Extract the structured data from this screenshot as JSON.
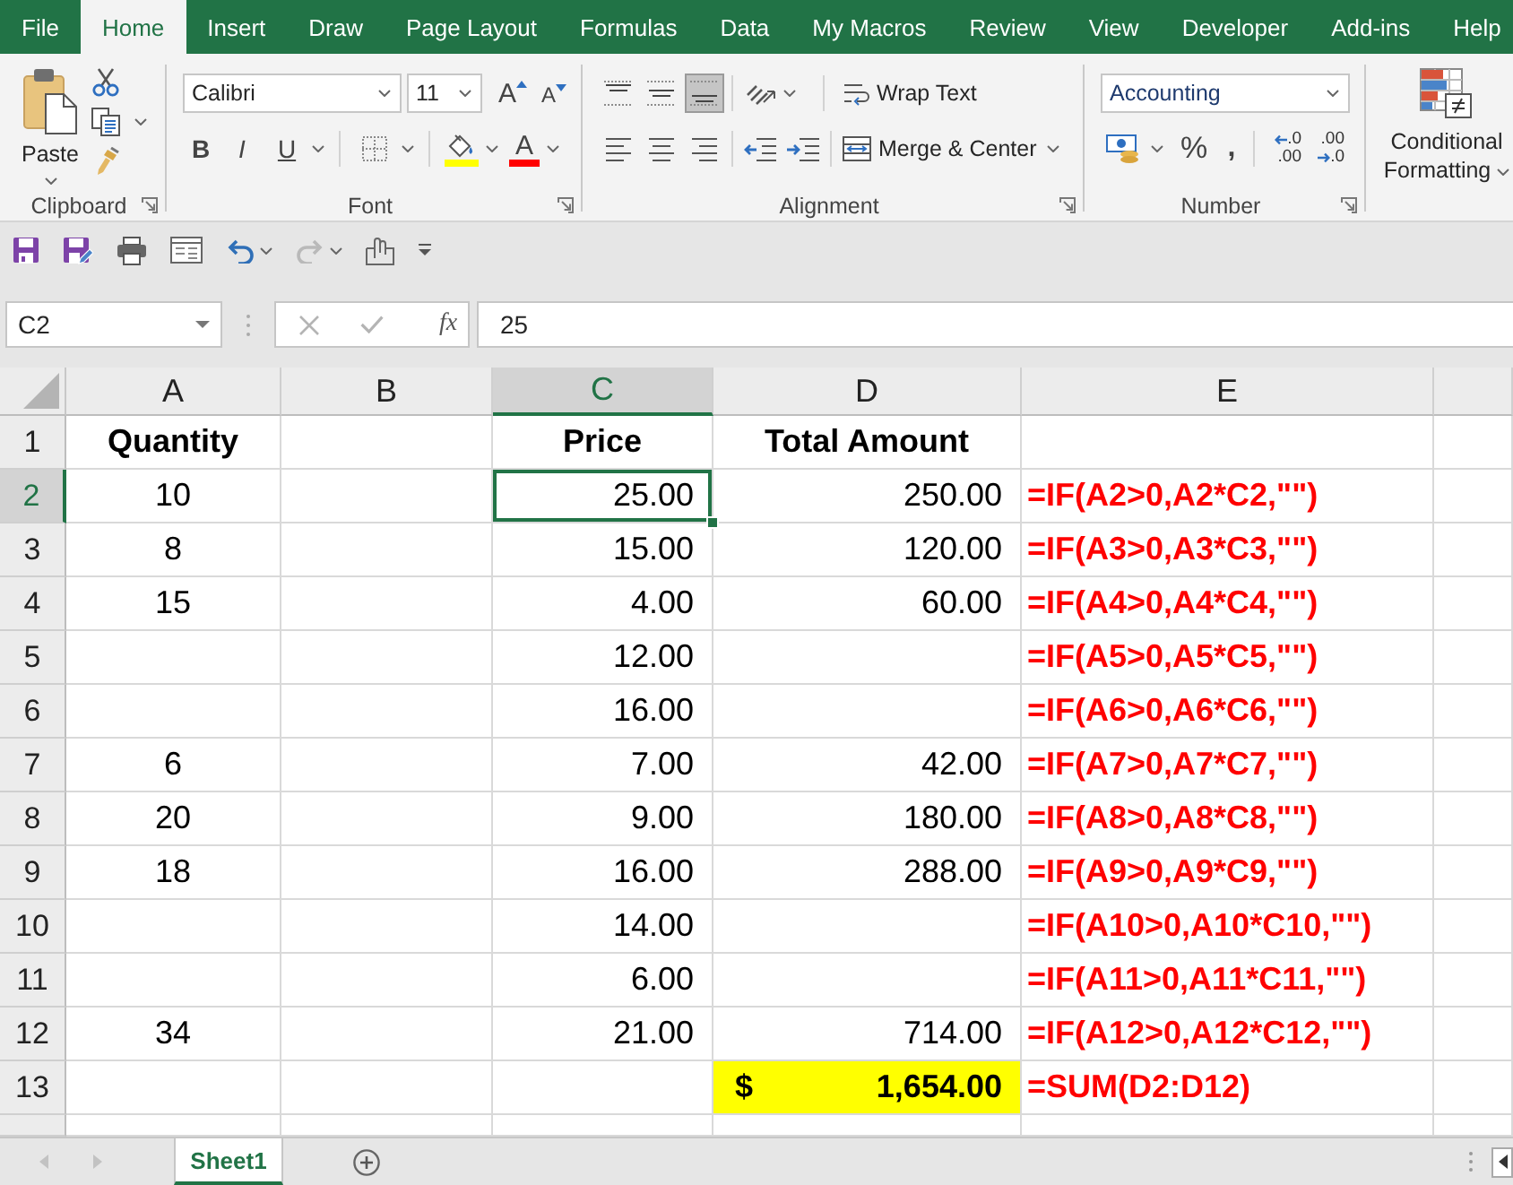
{
  "ribbon_tabs": [
    {
      "label": "File",
      "selected": false
    },
    {
      "label": "Home",
      "selected": true
    },
    {
      "label": "Insert",
      "selected": false
    },
    {
      "label": "Draw",
      "selected": false
    },
    {
      "label": "Page Layout",
      "selected": false
    },
    {
      "label": "Formulas",
      "selected": false
    },
    {
      "label": "Data",
      "selected": false
    },
    {
      "label": "My Macros",
      "selected": false
    },
    {
      "label": "Review",
      "selected": false
    },
    {
      "label": "View",
      "selected": false
    },
    {
      "label": "Developer",
      "selected": false
    },
    {
      "label": "Add-ins",
      "selected": false
    },
    {
      "label": "Help",
      "selected": false
    }
  ],
  "ribbon": {
    "clipboard": {
      "paste": "Paste",
      "label": "Clipboard"
    },
    "font": {
      "name": "Calibri",
      "size": "11",
      "grow": "A",
      "shrink": "A",
      "bold": "B",
      "italic": "I",
      "underline": "U",
      "text_tint": "A",
      "label": "Font"
    },
    "alignment": {
      "vertical": [
        {
          "kind": "top",
          "selected": false
        },
        {
          "kind": "middle",
          "selected": false
        },
        {
          "kind": "bottom",
          "selected": true
        }
      ],
      "horizontal": [
        {
          "kind": "left",
          "selected": false
        },
        {
          "kind": "center",
          "selected": false
        },
        {
          "kind": "right",
          "selected": false
        }
      ],
      "wrap_text": "Wrap Text",
      "merge_center": "Merge & Center",
      "label": "Alignment"
    },
    "number": {
      "format": "Accounting",
      "percent": "%",
      "comma": ",",
      "increase_decimal": [
        ".0",
        ".00"
      ],
      "decrease_decimal": [
        ".00",
        ".0"
      ],
      "label": "Number"
    },
    "styles": {
      "conditional_formatting": "Conditional Formatting"
    }
  },
  "quick_access": [
    {
      "kind": "save",
      "disabled": false
    },
    {
      "kind": "save_as",
      "disabled": false
    },
    {
      "kind": "print",
      "disabled": false
    },
    {
      "kind": "form",
      "disabled": false
    },
    {
      "kind": "undo",
      "disabled": false
    },
    {
      "kind": "redo",
      "disabled": true
    },
    {
      "kind": "touch",
      "disabled": false
    },
    {
      "kind": "customize",
      "disabled": false
    }
  ],
  "formula_bar": {
    "name_box": "C2",
    "edit_buttons_disabled": true,
    "function": "fx",
    "value": "25"
  },
  "grid": {
    "columns": [
      {
        "label": "A",
        "selected": false
      },
      {
        "label": "B",
        "selected": false
      },
      {
        "label": "C",
        "selected": true
      },
      {
        "label": "D",
        "selected": false
      },
      {
        "label": "E",
        "selected": false
      }
    ],
    "rows": [
      {
        "header": "1",
        "selected": false,
        "cells": [
          {
            "kind": "heading",
            "text": "Quantity",
            "selected": false
          },
          {
            "selected": false
          },
          {
            "kind": "heading",
            "text": "Price",
            "selected": false
          },
          {
            "kind": "heading",
            "text": "Total Amount",
            "selected": false
          },
          {
            "selected": false
          }
        ]
      },
      {
        "header": "2",
        "selected": true,
        "cells": [
          {
            "kind": "count",
            "text": "10",
            "selected": false
          },
          {
            "selected": false
          },
          {
            "kind": "amount",
            "text": "25.00",
            "selected": true
          },
          {
            "kind": "amount",
            "text": "250.00",
            "selected": false
          },
          {
            "kind": "formula",
            "text": "=IF(A2>0,A2*C2,\"\")",
            "selected": false
          }
        ]
      },
      {
        "header": "3",
        "selected": false,
        "cells": [
          {
            "kind": "count",
            "text": "8",
            "selected": false
          },
          {
            "selected": false
          },
          {
            "kind": "amount",
            "text": "15.00",
            "selected": false
          },
          {
            "kind": "amount",
            "text": "120.00",
            "selected": false
          },
          {
            "kind": "formula",
            "text": "=IF(A3>0,A3*C3,\"\")",
            "selected": false
          }
        ]
      },
      {
        "header": "4",
        "selected": false,
        "cells": [
          {
            "kind": "count",
            "text": "15",
            "selected": false
          },
          {
            "selected": false
          },
          {
            "kind": "amount",
            "text": "4.00",
            "selected": false
          },
          {
            "kind": "amount",
            "text": "60.00",
            "selected": false
          },
          {
            "kind": "formula",
            "text": "=IF(A4>0,A4*C4,\"\")",
            "selected": false
          }
        ]
      },
      {
        "header": "5",
        "selected": false,
        "cells": [
          {
            "selected": false
          },
          {
            "selected": false
          },
          {
            "kind": "amount",
            "text": "12.00",
            "selected": false
          },
          {
            "selected": false
          },
          {
            "kind": "formula",
            "text": "=IF(A5>0,A5*C5,\"\")",
            "selected": false
          }
        ]
      },
      {
        "header": "6",
        "selected": false,
        "cells": [
          {
            "selected": false
          },
          {
            "selected": false
          },
          {
            "kind": "amount",
            "text": "16.00",
            "selected": false
          },
          {
            "selected": false
          },
          {
            "kind": "formula",
            "text": "=IF(A6>0,A6*C6,\"\")",
            "selected": false
          }
        ]
      },
      {
        "header": "7",
        "selected": false,
        "cells": [
          {
            "kind": "count",
            "text": "6",
            "selected": false
          },
          {
            "selected": false
          },
          {
            "kind": "amount",
            "text": "7.00",
            "selected": false
          },
          {
            "kind": "amount",
            "text": "42.00",
            "selected": false
          },
          {
            "kind": "formula",
            "text": "=IF(A7>0,A7*C7,\"\")",
            "selected": false
          }
        ]
      },
      {
        "header": "8",
        "selected": false,
        "cells": [
          {
            "kind": "count",
            "text": "20",
            "selected": false
          },
          {
            "selected": false
          },
          {
            "kind": "amount",
            "text": "9.00",
            "selected": false
          },
          {
            "kind": "amount",
            "text": "180.00",
            "selected": false
          },
          {
            "kind": "formula",
            "text": "=IF(A8>0,A8*C8,\"\")",
            "selected": false
          }
        ]
      },
      {
        "header": "9",
        "selected": false,
        "cells": [
          {
            "kind": "count",
            "text": "18",
            "selected": false
          },
          {
            "selected": false
          },
          {
            "kind": "amount",
            "text": "16.00",
            "selected": false
          },
          {
            "kind": "amount",
            "text": "288.00",
            "selected": false
          },
          {
            "kind": "formula",
            "text": "=IF(A9>0,A9*C9,\"\")",
            "selected": false
          }
        ]
      },
      {
        "header": "10",
        "selected": false,
        "cells": [
          {
            "selected": false
          },
          {
            "selected": false
          },
          {
            "kind": "amount",
            "text": "14.00",
            "selected": false
          },
          {
            "selected": false
          },
          {
            "kind": "formula",
            "text": "=IF(A10>0,A10*C10,\"\")",
            "selected": false
          }
        ]
      },
      {
        "header": "11",
        "selected": false,
        "cells": [
          {
            "selected": false
          },
          {
            "selected": false
          },
          {
            "kind": "amount",
            "text": "6.00",
            "selected": false
          },
          {
            "selected": false
          },
          {
            "kind": "formula",
            "text": "=IF(A11>0,A11*C11,\"\")",
            "selected": false
          }
        ]
      },
      {
        "header": "12",
        "selected": false,
        "cells": [
          {
            "kind": "count",
            "text": "34",
            "selected": false
          },
          {
            "selected": false
          },
          {
            "kind": "amount",
            "text": "21.00",
            "selected": false
          },
          {
            "kind": "amount",
            "text": "714.00",
            "selected": false
          },
          {
            "kind": "formula",
            "text": "=IF(A12>0,A12*C12,\"\")",
            "selected": false
          }
        ]
      },
      {
        "header": "13",
        "selected": false,
        "cells": [
          {
            "selected": false
          },
          {
            "selected": false
          },
          {
            "selected": false
          },
          {
            "kind": "accounting",
            "symbol": "$",
            "text": "1,654.00",
            "selected": false
          },
          {
            "kind": "formula",
            "text": "=SUM(D2:D12)",
            "selected": false
          }
        ]
      }
    ]
  },
  "sheet_tabs": [
    {
      "label": "Sheet1",
      "selected": true
    }
  ]
}
